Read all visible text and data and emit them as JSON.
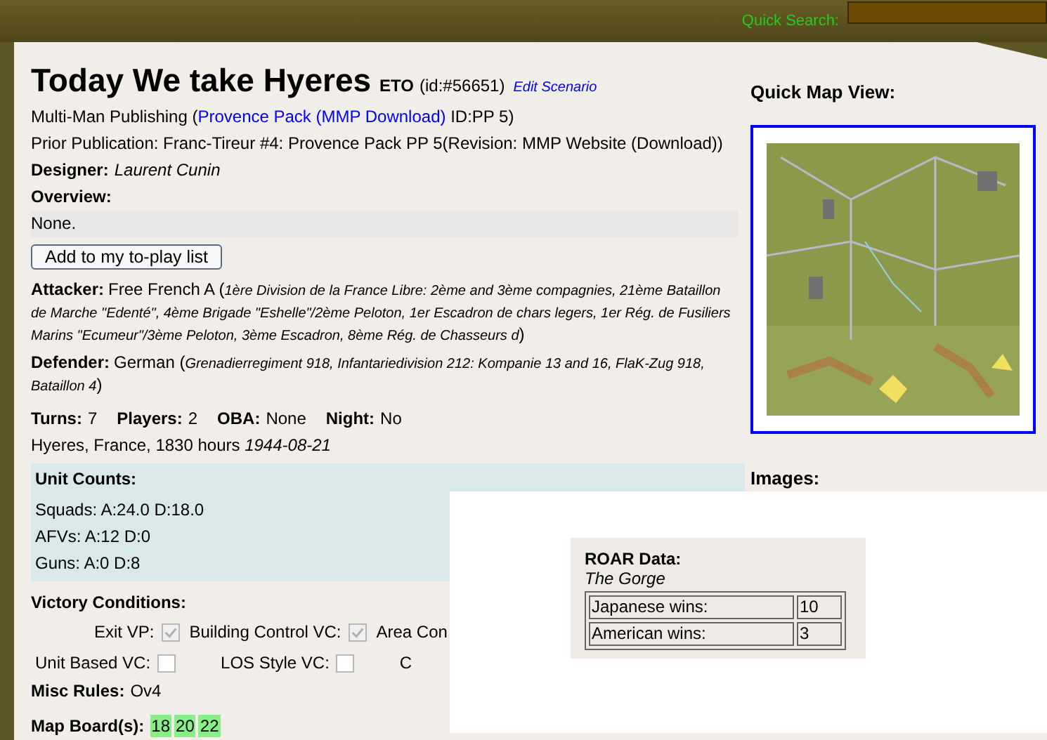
{
  "top_bar": {
    "search_label": "Quick Search:"
  },
  "scenario": {
    "title": "Today We take Hyeres",
    "theater": "ETO",
    "id_text": "(id:#56651)",
    "edit_link": "Edit Scenario",
    "publisher_line": {
      "before": "Multi-Man Publishing (",
      "link": "Provence Pack (MMP Download)",
      "after": " ID:PP 5)"
    },
    "prior_publication": "Prior Publication: Franc-Tireur #4: Provence Pack PP 5(Revision: MMP Website (Download))",
    "designer": {
      "label": "Designer:",
      "value": "Laurent Cunin"
    },
    "overview": {
      "label": "Overview:",
      "text": "None."
    },
    "to_play_button": "Add to my to-play list",
    "sides": [
      {
        "label": "Attacker:",
        "text": "Free French A (*1ère Division de la France Libre: 2ème and 3ème compagnies, 21ème Bataillon de Marche \"Edenté\", 4ème Brigade \"Eshelle\"/2ème Peloton, 1er Escadron de chars legers, 1er Rég. de Fusiliers Marins \"Ecumeur\"/3ème Peloton, 3ème Escadron, 8ème Rég. de Chasseurs d*)"
      },
      {
        "label": "Defender:",
        "text": "German (*Grenadierregiment 918, Infantariedivision 212: Kompanie 13 and 16, FlaK-Zug 918, Bataillon 4*)"
      }
    ],
    "stats": [
      {
        "label": "Turns:",
        "value": "7"
      },
      {
        "label": "Players:",
        "value": "2"
      },
      {
        "label": "OBA:",
        "value": "None"
      },
      {
        "label": "Night:",
        "value": "No"
      }
    ],
    "location": "Hyeres, France, 1830 hours *1944-08-21*",
    "unit_counts": {
      "title": "Unit Counts:",
      "rows": [
        "Squads: A:24.0 D:18.0",
        "AFVs: A:12 D:0",
        "Guns: A:0 D:8"
      ]
    },
    "victory_conditions": {
      "title": "Victory Conditions:",
      "rows": [
        [
          {
            "kind": "checkbox",
            "label": "Exit VP:",
            "checked": true
          },
          {
            "kind": "checkbox",
            "label": "Building Control VC:",
            "checked": true
          },
          {
            "kind": "text",
            "label": "Area Con"
          }
        ],
        [
          {
            "kind": "checkbox",
            "label": "Unit Based VC:",
            "checked": false
          },
          {
            "kind": "checkbox",
            "label": "LOS Style VC:",
            "checked": false
          },
          {
            "kind": "text",
            "label": "C"
          }
        ]
      ]
    },
    "misc_rules": {
      "label": "Misc Rules:",
      "value": "Ov4"
    },
    "map_boards": {
      "label": "Map Board(s):",
      "boards": [
        "18",
        "20",
        "22"
      ]
    }
  },
  "sidebar": {
    "map_title": "Quick Map View:",
    "images_title": "Images:"
  },
  "roar_popup": {
    "title": "ROAR Data:",
    "scenario": "The Gorge",
    "rows": [
      {
        "label": "Japanese wins:",
        "value": "10"
      },
      {
        "label": "American wins:",
        "value": "3"
      }
    ]
  }
}
